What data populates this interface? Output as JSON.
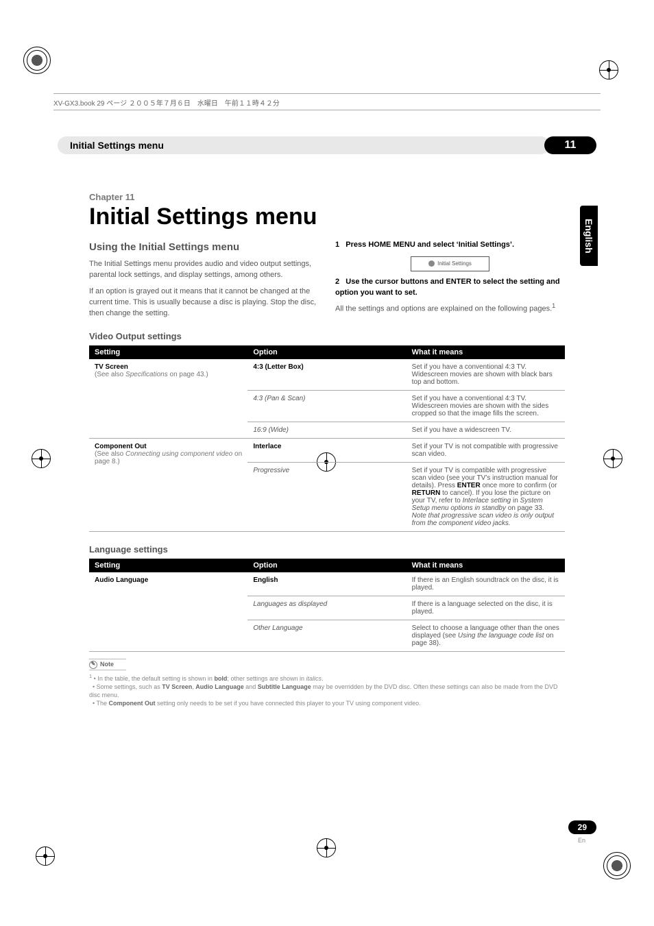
{
  "header_strip": "XV-GX3.book  29 ページ  ２００５年７月６日　水曜日　午前１１時４２分",
  "section_title": "Initial Settings menu",
  "chapter_number": "11",
  "side_tab": "English",
  "chapter_line": "Chapter 11",
  "h1": "Initial Settings menu",
  "left_col": {
    "heading": "Using the Initial Settings menu",
    "p1": "The Initial Settings menu provides audio and video output settings, parental lock settings, and display settings, among others.",
    "p2": "If an option is grayed out it means that it cannot be changed at the current time. This is usually because a disc is playing. Stop the disc, then change the setting."
  },
  "right_col": {
    "step1_num": "1",
    "step1": "Press HOME MENU and select ‘Initial Settings’.",
    "initial_box": "Initial Settings",
    "step2_num": "2",
    "step2": "Use the cursor buttons and ENTER to select the setting and option you want to set.",
    "p3": "All the settings and options are explained on the following pages.",
    "fn": "1"
  },
  "video_heading": "Video Output settings",
  "table_head": {
    "c1": "Setting",
    "c2": "Option",
    "c3": "What it means"
  },
  "video_rows": {
    "tv_screen": {
      "label": "TV Screen",
      "sub_a": "(See also ",
      "sub_i": "Specifications",
      "sub_b": " on page 43.)"
    },
    "r1_opt": "4:3 (Letter Box)",
    "r1_txt": "Set if you have a conventional 4:3 TV. Widescreen movies are shown with black bars top and bottom.",
    "r2_opt": "4:3 (Pan & Scan)",
    "r2_txt": "Set if you have a conventional 4:3 TV. Widescreen movies are shown with the sides cropped so that the image fills the screen.",
    "r3_opt": "16:9 (Wide)",
    "r3_txt": "Set if you have a widescreen TV.",
    "comp_out": {
      "label": "Component Out",
      "sub_a": "(See also ",
      "sub_i": "Connecting using component video",
      "sub_b": " on page 8.)"
    },
    "r4_opt": "Interlace",
    "r4_txt": "Set if your TV is not compatible with progressive scan video.",
    "r5_opt": "Progressive",
    "r5_txt_a": "Set if your TV is compatible with progressive scan video (see your TV’s instruction manual for details). Press ",
    "r5_b1": "ENTER",
    "r5_txt_b": " once more to confirm (or ",
    "r5_b2": "RETURN",
    "r5_txt_c": " to cancel). If you lose the picture on your TV, refer to ",
    "r5_i1": "Interlace setting",
    "r5_txt_d": " in ",
    "r5_i2": "System Setup menu options in standby",
    "r5_txt_e": " on page 33.",
    "r5_i3": "Note that progressive scan video is only output from the component video jacks."
  },
  "lang_heading": "Language settings",
  "lang_rows": {
    "al": "Audio Language",
    "r1_opt": "English",
    "r1_txt": "If there is an English soundtrack on the disc, it is played.",
    "r2_opt": "Languages as displayed",
    "r2_txt": "If there is a language selected on the disc, it is played.",
    "r3_opt": "Other Language",
    "r3_txt_a": "Select to choose a language other than the ones displayed (see ",
    "r3_i": "Using the language code list",
    "r3_txt_b": " on page 38)."
  },
  "note": {
    "label": "Note",
    "l1a": "In the table, the default setting is shown in ",
    "l1b": "bold",
    "l1c": "; other settings are shown in ",
    "l1d": "italics",
    "l1e": ".",
    "l2a": "Some settings, such as ",
    "l2b": "TV Screen",
    "l2c": ", ",
    "l2d": "Audio Language",
    "l2e": " and ",
    "l2f": "Subtitle Language",
    "l2g": " may be overridden by the DVD disc. Often these settings can also be made from the DVD disc menu.",
    "l3a": "The ",
    "l3b": "Component Out",
    "l3c": " setting only needs to be set if you have connected this player to your TV using component video.",
    "one": "1"
  },
  "page_num": "29",
  "page_en": "En"
}
